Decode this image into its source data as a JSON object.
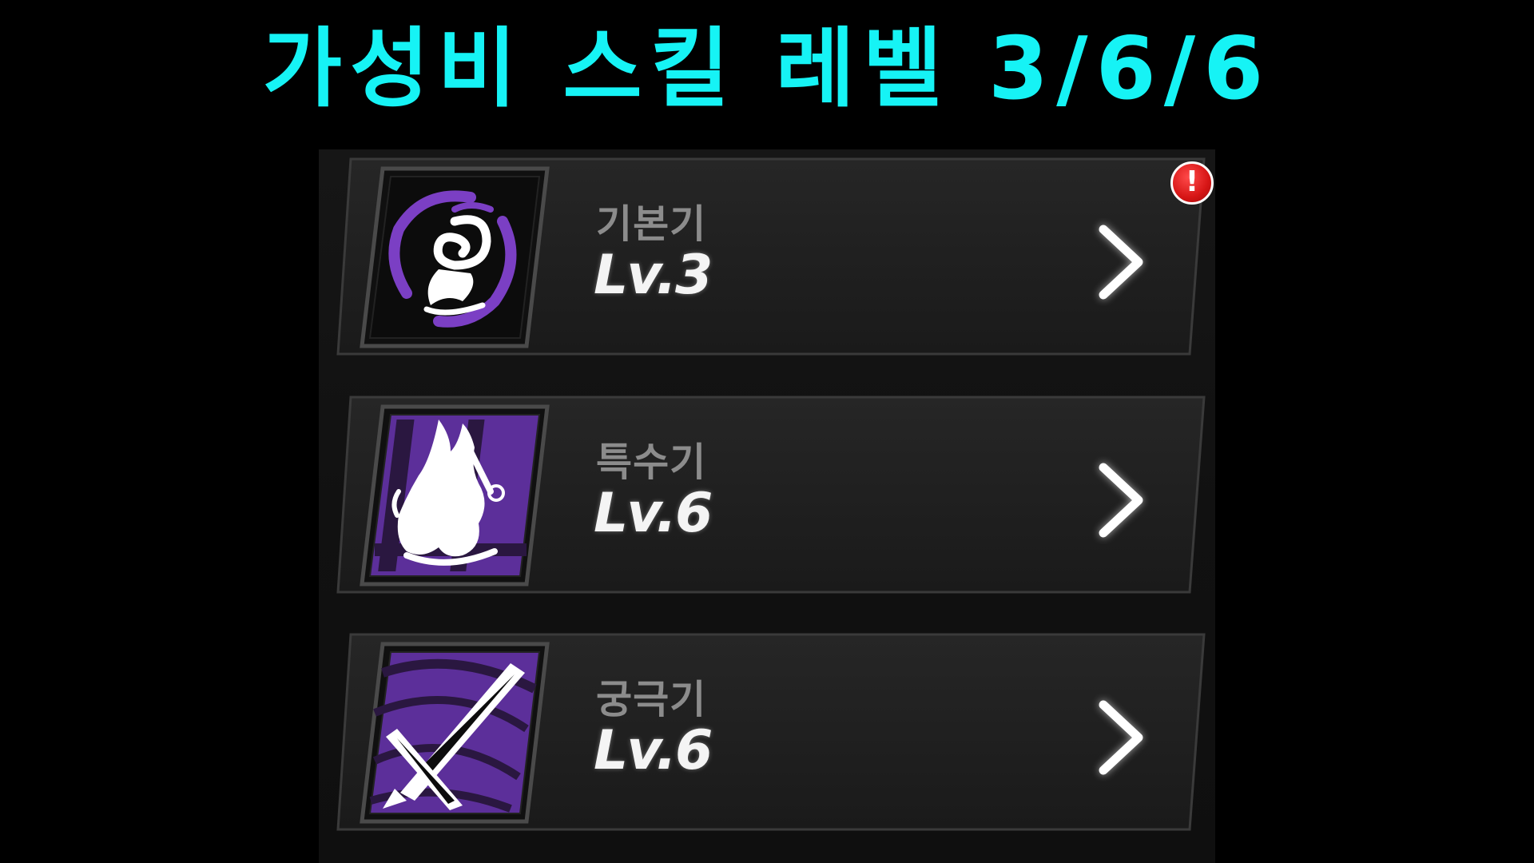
{
  "headline": "가성비 스킬 레벨 3/6/6",
  "skills": [
    {
      "type": "기본기",
      "level": "Lv.3",
      "icon": "swirl-spirit-icon",
      "has_alert": true
    },
    {
      "type": "특수기",
      "level": "Lv.6",
      "icon": "white-flame-burst-icon",
      "has_alert": false
    },
    {
      "type": "궁극기",
      "level": "Lv.6",
      "icon": "crossed-blade-slash-icon",
      "has_alert": false
    }
  ],
  "alert_symbol": "!",
  "colors": {
    "headline": "#16f3f5",
    "accent_purple": "#7b3fc4",
    "alert_red": "#d61515",
    "panel_bg": "#141414"
  }
}
